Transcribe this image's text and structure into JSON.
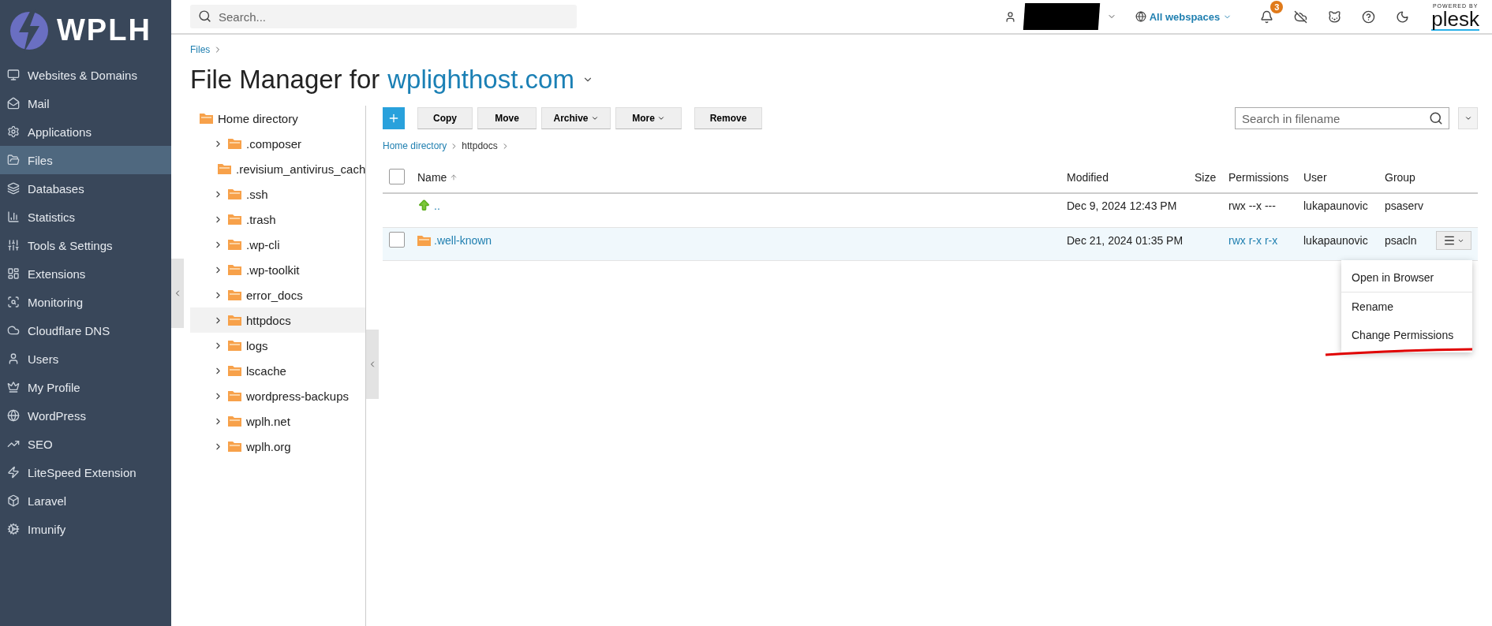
{
  "sidebar": {
    "logo": "WPLH",
    "items": [
      {
        "label": "Websites & Domains",
        "selected": false
      },
      {
        "label": "Mail",
        "selected": false
      },
      {
        "label": "Applications",
        "selected": false
      },
      {
        "label": "Files",
        "selected": true
      },
      {
        "label": "Databases",
        "selected": false
      },
      {
        "label": "Statistics",
        "selected": false
      },
      {
        "label": "Tools & Settings",
        "selected": false
      },
      {
        "label": "Extensions",
        "selected": false
      },
      {
        "label": "Monitoring",
        "selected": false
      },
      {
        "label": "Cloudflare DNS",
        "selected": false
      },
      {
        "label": "Users",
        "selected": false
      },
      {
        "label": "My Profile",
        "selected": false
      },
      {
        "label": "WordPress",
        "selected": false
      },
      {
        "label": "SEO",
        "selected": false
      },
      {
        "label": "LiteSpeed Extension",
        "selected": false
      },
      {
        "label": "Laravel",
        "selected": false
      },
      {
        "label": "Imunify",
        "selected": false
      }
    ]
  },
  "topbar": {
    "search": {
      "placeholder": "Search..."
    },
    "webspaces": "All webspaces",
    "notifications": "3",
    "powered_by": "POWERED BY",
    "brand": "plesk"
  },
  "breadcrumb": [
    "Files"
  ],
  "title": {
    "prefix": "File Manager for",
    "domain": "wplighthost.com"
  },
  "tree": {
    "root": "Home directory",
    "children": [
      {
        "name": ".composer",
        "selected": false
      },
      {
        "name": ".revisium_antivirus_cach",
        "selected": false
      },
      {
        "name": ".ssh",
        "selected": false
      },
      {
        "name": ".trash",
        "selected": false
      },
      {
        "name": ".wp-cli",
        "selected": false
      },
      {
        "name": ".wp-toolkit",
        "selected": false
      },
      {
        "name": "error_docs",
        "selected": false
      },
      {
        "name": "httpdocs",
        "selected": true
      },
      {
        "name": "logs",
        "selected": false
      },
      {
        "name": "lscache",
        "selected": false
      },
      {
        "name": "wordpress-backups",
        "selected": false
      },
      {
        "name": "wplh.net",
        "selected": false
      },
      {
        "name": "wplh.org",
        "selected": false
      }
    ]
  },
  "toolbar": {
    "buttons": [
      {
        "label": "Copy",
        "dropdown": false
      },
      {
        "label": "Move",
        "dropdown": false
      },
      {
        "label": "Archive",
        "dropdown": true
      },
      {
        "label": "More",
        "dropdown": true
      },
      {
        "label": "Remove",
        "dropdown": false
      }
    ],
    "search": {
      "placeholder": "Search in filename"
    }
  },
  "path": [
    "Home directory",
    "httpdocs"
  ],
  "table": {
    "select_all_checked": false,
    "columns": [
      "Name",
      "Modified",
      "Size",
      "Permissions",
      "User",
      "Group"
    ],
    "rows": [
      {
        "kind": "parent",
        "name": "..",
        "modified": "Dec 9, 2024 12:43 PM",
        "permissions": "rwx --x ---",
        "user": "lukapaunovic",
        "group": "psaserv",
        "hovered": false
      },
      {
        "kind": "folder",
        "name": ".well-known",
        "modified": "Dec 21, 2024 01:35 PM",
        "permissions": "rwx r-x r-x",
        "user": "lukapaunovic",
        "group": "psacln",
        "hovered": true,
        "checked": false
      }
    ]
  },
  "context_menu": {
    "items": [
      {
        "label": "Open in Browser",
        "separator_after": true
      },
      {
        "label": "Rename",
        "separator_after": false
      },
      {
        "label": "Change Permissions",
        "separator_after": false
      }
    ]
  }
}
